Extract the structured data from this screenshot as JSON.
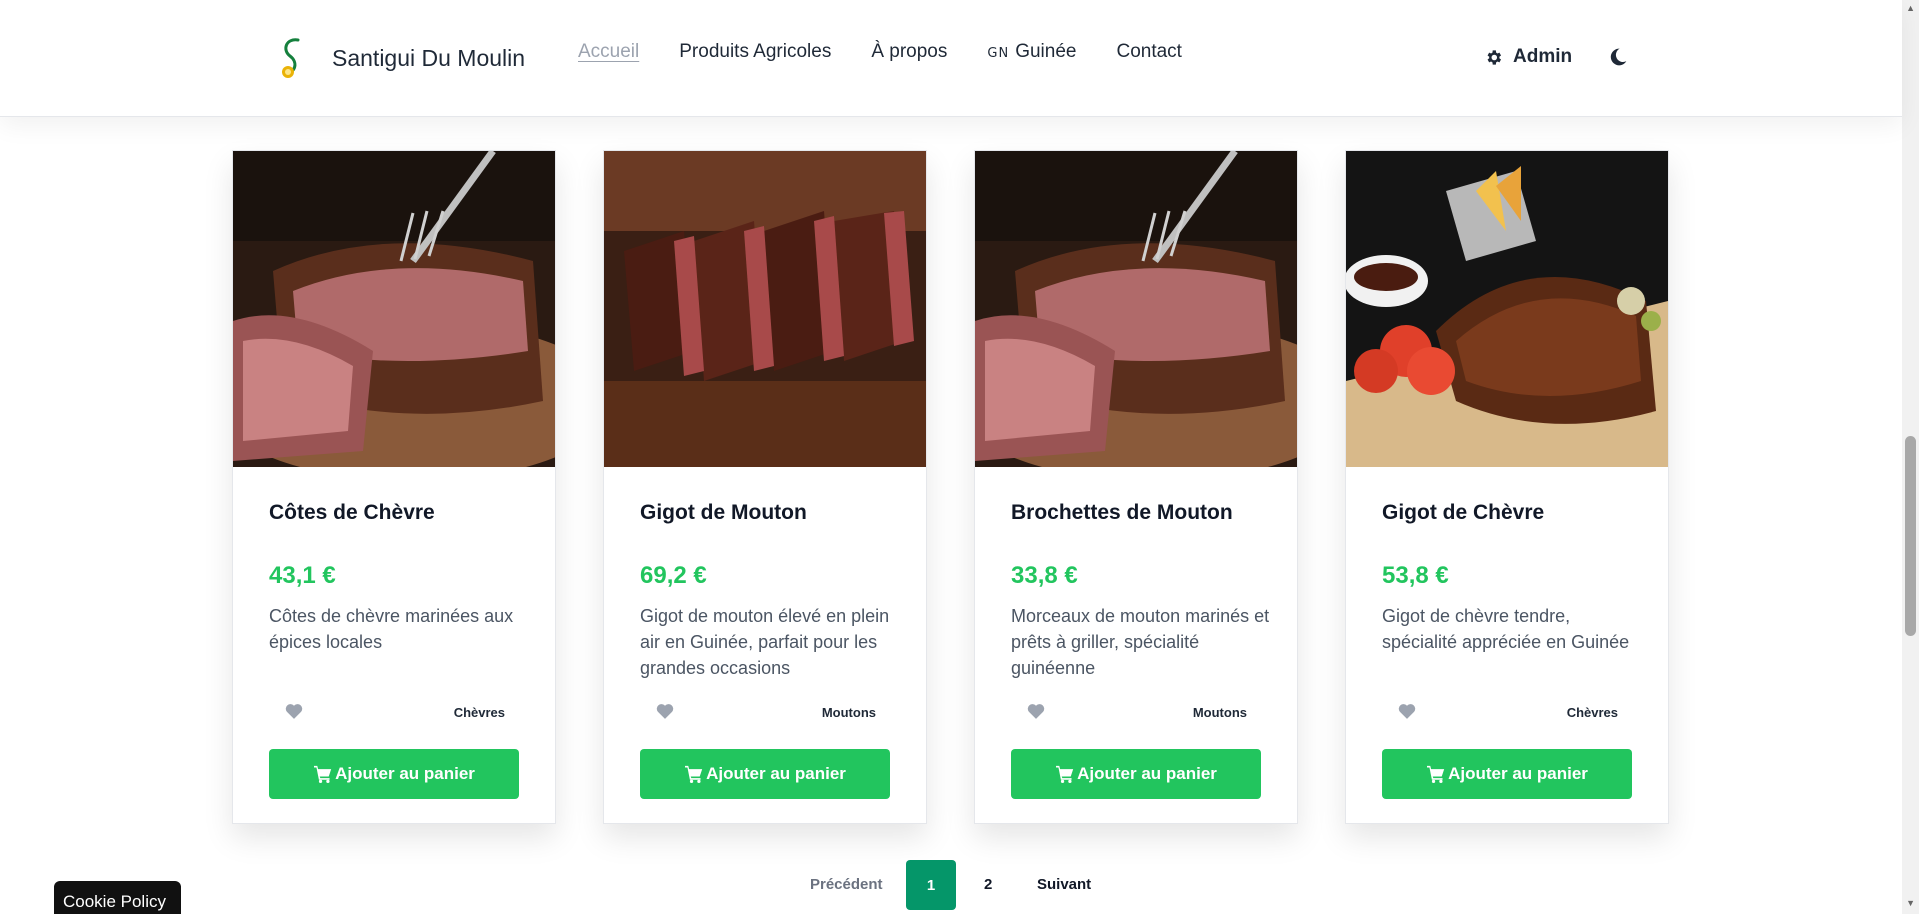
{
  "header": {
    "brand": "Santigui Du Moulin",
    "nav": {
      "accueil": "Accueil",
      "produits": "Produits Agricoles",
      "apropos": "À propos",
      "guinee_flag": "GN",
      "guinee": "Guinée",
      "contact": "Contact"
    },
    "admin_label": "Admin",
    "icons": {
      "admin": "gear-icon",
      "theme": "moon-icon"
    }
  },
  "products": [
    {
      "name": "Côtes de Chèvre",
      "price": "43,1 €",
      "description": "Côtes de chèvre marinées aux épices locales",
      "category": "Chèvres",
      "cta": "Ajouter au panier",
      "image": "sliced-grilled-meat-with-fork"
    },
    {
      "name": "Gigot de Mouton",
      "price": "69,2 €",
      "description": "Gigot de mouton élevé en plein air en Guinée, parfait pour les grandes occasions",
      "category": "Moutons",
      "cta": "Ajouter au panier",
      "image": "sliced-steak-on-board"
    },
    {
      "name": "Brochettes de Mouton",
      "price": "33,8 €",
      "description": "Morceaux de mouton marinés et prêts à griller, spécialité guinéenne",
      "category": "Moutons",
      "cta": "Ajouter au panier",
      "image": "sliced-grilled-meat-with-fork"
    },
    {
      "name": "Gigot de Chèvre",
      "price": "53,8 €",
      "description": "Gigot de chèvre tendre, spécialité appréciée en Guinée",
      "category": "Chèvres",
      "cta": "Ajouter au panier",
      "image": "ribs-with-fries-and-tomatoes"
    }
  ],
  "pagination": {
    "prev": "Précédent",
    "pages": [
      "1",
      "2"
    ],
    "current": "1",
    "next": "Suivant"
  },
  "cookie": {
    "label": "Cookie Policy"
  },
  "colors": {
    "accent": "#22c55e",
    "active_page": "#059669"
  }
}
